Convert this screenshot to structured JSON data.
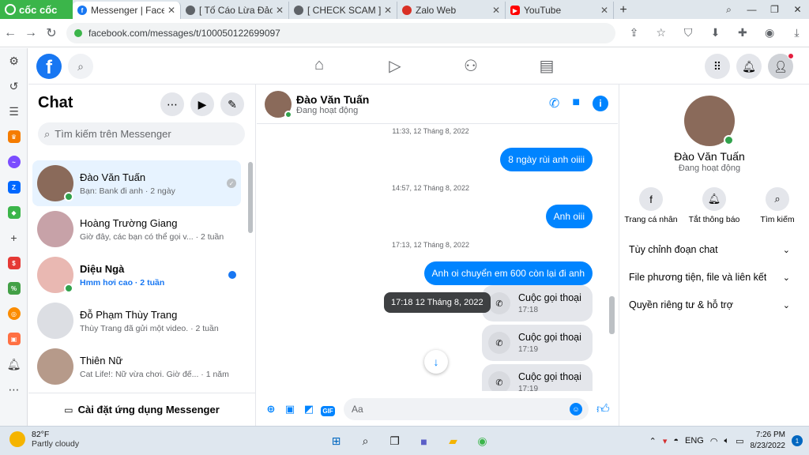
{
  "browser": {
    "brand": "cốc cốc",
    "tabs": [
      {
        "title": "Messenger | Facebook",
        "icon": "facebook-icon",
        "color": "#1877f2"
      },
      {
        "title": "[ Tố Cáo Lừa Đảo",
        "icon": "globe-icon",
        "color": "#5f6368"
      },
      {
        "title": "[ CHECK SCAM ] H",
        "icon": "globe-icon",
        "color": "#5f6368"
      },
      {
        "title": "Zalo Web",
        "icon": "zalo-icon",
        "color": "#d93025"
      },
      {
        "title": "YouTube",
        "icon": "youtube-icon",
        "color": "#ff0000"
      }
    ],
    "url": "facebook.com/messages/t/100050122699097"
  },
  "chat_list": {
    "title": "Chat",
    "search_placeholder": "Tìm kiếm trên Messenger",
    "items": [
      {
        "name": "Đào Văn Tuấn",
        "preview": "Bạn: Bank đi anh · 2 ngày",
        "unread": false,
        "online": true,
        "active": true,
        "color": "#8a6a5a"
      },
      {
        "name": "Hoàng Trường Giang",
        "preview": "Giờ đây, các bạn có thể gọi v... · 2 tuần",
        "unread": false,
        "online": false,
        "active": false,
        "color": "#c7a2a8"
      },
      {
        "name": "Diệu Ngà",
        "preview": "Hmm hơi cao · 2 tuần",
        "unread": true,
        "online": true,
        "active": false,
        "color": "#e9b8b2"
      },
      {
        "name": "Đỗ Phạm Thùy Trang",
        "preview": "Thùy Trang đã gửi một video. · 2 tuần",
        "unread": false,
        "online": false,
        "active": false,
        "color": "#dcdee3"
      },
      {
        "name": "Thiên Nữ",
        "preview": "Cat Life!: Nữ vừa chơi. Giờ đế... · 1 năm",
        "unread": false,
        "online": false,
        "active": false,
        "color": "#b69a8a"
      }
    ],
    "install_label": "Cài đặt ứng dụng Messenger"
  },
  "conversation": {
    "name": "Đào Văn Tuấn",
    "status": "Đang hoạt động",
    "timestamps": [
      "11:33, 12 Tháng 8, 2022",
      "14:57, 12 Tháng 8, 2022",
      "17:13, 12 Tháng 8, 2022"
    ],
    "messages": [
      "8 ngày rùi anh oiiii",
      "Anh oiii",
      "Anh oi chuyển em 600 còn lại đi anh"
    ],
    "calls": [
      {
        "label": "Cuộc gọi thoại",
        "time": "17:18"
      },
      {
        "label": "Cuộc gọi thoại",
        "time": "17:19"
      },
      {
        "label": "Cuộc gọi thoại",
        "time": "17:19"
      }
    ],
    "tooltip": "17:18 12 Tháng 8, 2022",
    "composer_placeholder": "Aa"
  },
  "info_panel": {
    "name": "Đào Văn Tuấn",
    "status": "Đang hoạt động",
    "actions": [
      "Trang cá nhân",
      "Tắt thông báo",
      "Tìm kiếm"
    ],
    "sections": [
      "Tùy chỉnh đoạn chat",
      "File phương tiện, file và liên kết",
      "Quyền riêng tư & hỗ trợ"
    ]
  },
  "taskbar": {
    "temperature": "82°F",
    "weather": "Partly cloudy",
    "language": "ENG",
    "time": "7:26 PM",
    "date": "8/23/2022",
    "notifications": "1"
  }
}
